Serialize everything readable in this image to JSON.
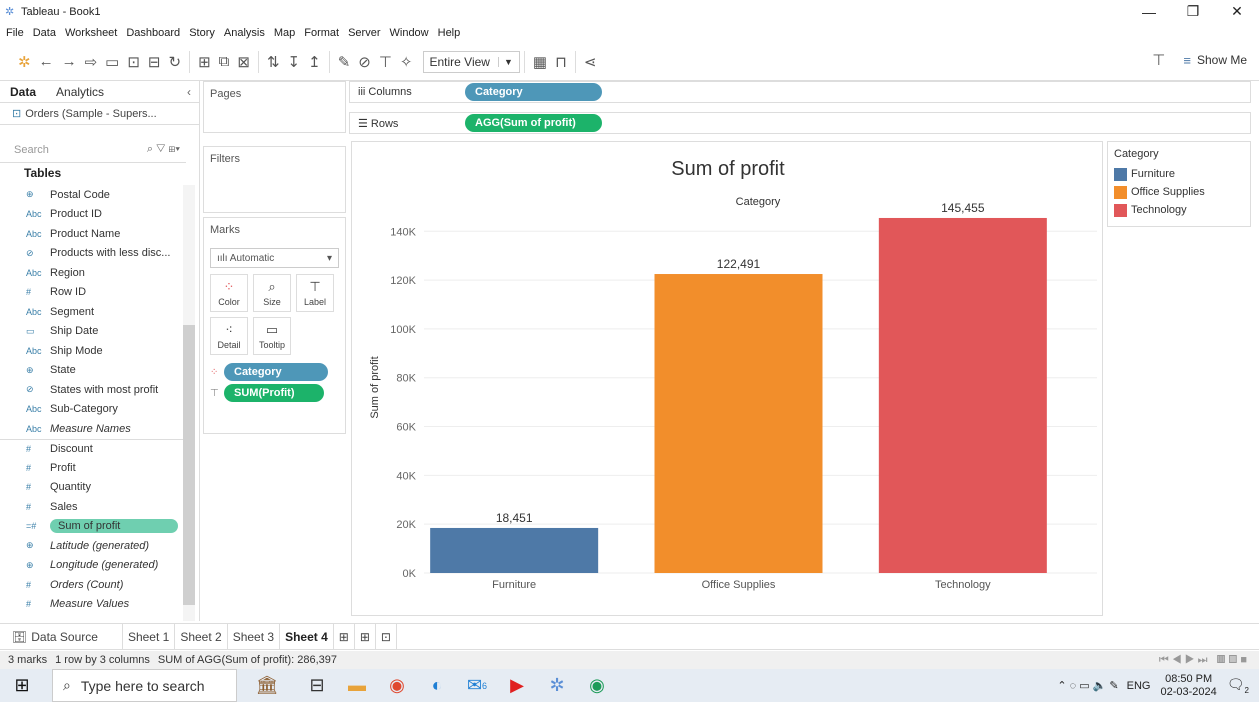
{
  "window": {
    "title": "Tableau - Book1",
    "minimize": "—",
    "restore": "❐",
    "close": "✕"
  },
  "menu": [
    "File",
    "Data",
    "Worksheet",
    "Dashboard",
    "Story",
    "Analysis",
    "Map",
    "Format",
    "Server",
    "Window",
    "Help"
  ],
  "toolbar": {
    "entire_view": "Entire View",
    "show_me": "Show Me"
  },
  "datapane": {
    "tab_data": "Data",
    "tab_analytics": "Analytics",
    "source": "Orders (Sample - Supers...",
    "search_placeholder": "Search",
    "tables_header": "Tables",
    "fields": [
      {
        "icon": "⊕",
        "label": "Postal Code",
        "italic": false
      },
      {
        "icon": "Abc",
        "label": "Product ID",
        "italic": false
      },
      {
        "icon": "Abc",
        "label": "Product Name",
        "italic": false
      },
      {
        "icon": "⊘",
        "label": "Products with less disc...",
        "italic": false
      },
      {
        "icon": "Abc",
        "label": "Region",
        "italic": false
      },
      {
        "icon": "#",
        "label": "Row ID",
        "italic": false
      },
      {
        "icon": "Abc",
        "label": "Segment",
        "italic": false
      },
      {
        "icon": "▭",
        "label": "Ship Date",
        "italic": false
      },
      {
        "icon": "Abc",
        "label": "Ship Mode",
        "italic": false
      },
      {
        "icon": "⊕",
        "label": "State",
        "italic": false
      },
      {
        "icon": "⊘",
        "label": "States with most profit",
        "italic": false
      },
      {
        "icon": "Abc",
        "label": "Sub-Category",
        "italic": false
      },
      {
        "icon": "Abc",
        "label": "Measure Names",
        "italic": true
      },
      {
        "icon": "#",
        "label": "Discount",
        "italic": false
      },
      {
        "icon": "#",
        "label": "Profit",
        "italic": false
      },
      {
        "icon": "#",
        "label": "Quantity",
        "italic": false
      },
      {
        "icon": "#",
        "label": "Sales",
        "italic": false
      },
      {
        "icon": "=#",
        "label": "Sum of profit",
        "italic": false,
        "pill": true
      },
      {
        "icon": "⊕",
        "label": "Latitude (generated)",
        "italic": true
      },
      {
        "icon": "⊕",
        "label": "Longitude (generated)",
        "italic": true
      },
      {
        "icon": "#",
        "label": "Orders (Count)",
        "italic": true
      },
      {
        "icon": "#",
        "label": "Measure Values",
        "italic": true
      }
    ]
  },
  "cards": {
    "pages": "Pages",
    "filters": "Filters",
    "marks": "Marks",
    "mark_type": "Automatic",
    "buttons": [
      "Color",
      "Size",
      "Label",
      "Detail",
      "Tooltip"
    ],
    "mark_pills": [
      "Category",
      "SUM(Profit)"
    ]
  },
  "shelves": {
    "columns_label": "Columns",
    "columns_pill": "Category",
    "rows_label": "Rows",
    "rows_pill": "AGG(Sum of profit)"
  },
  "chart_data": {
    "type": "bar",
    "title": "Sum of profit",
    "subtitle": "Category",
    "ylabel": "Sum of profit",
    "xlabel": "",
    "categories": [
      "Furniture",
      "Office Supplies",
      "Technology"
    ],
    "values": [
      18451,
      122491,
      145455
    ],
    "value_labels": [
      "18,451",
      "122,491",
      "145,455"
    ],
    "colors": [
      "#4e79a7",
      "#f28e2b",
      "#e15759"
    ],
    "yticks": [
      0,
      20000,
      40000,
      60000,
      80000,
      100000,
      120000,
      140000
    ],
    "ytick_labels": [
      "0K",
      "20K",
      "40K",
      "60K",
      "80K",
      "100K",
      "120K",
      "140K"
    ],
    "ylim": [
      0,
      152000
    ],
    "grid": true
  },
  "legend": {
    "title": "Category",
    "items": [
      {
        "label": "Furniture",
        "color": "#4e79a7"
      },
      {
        "label": "Office Supplies",
        "color": "#f28e2b"
      },
      {
        "label": "Technology",
        "color": "#e15759"
      }
    ]
  },
  "sheets": {
    "data_source": "Data Source",
    "tabs": [
      "Sheet 1",
      "Sheet 2",
      "Sheet 3",
      "Sheet 4"
    ],
    "active": "Sheet 4"
  },
  "status": {
    "marks": "3 marks",
    "layout": "1 row by 3 columns",
    "sum": "SUM of AGG(Sum of profit): 286,397"
  },
  "taskbar": {
    "search_placeholder": "Type here to search",
    "lang": "ENG",
    "time": "08:50 PM",
    "date": "02-03-2024",
    "badge_mail": "6",
    "badge_notif": "2"
  }
}
